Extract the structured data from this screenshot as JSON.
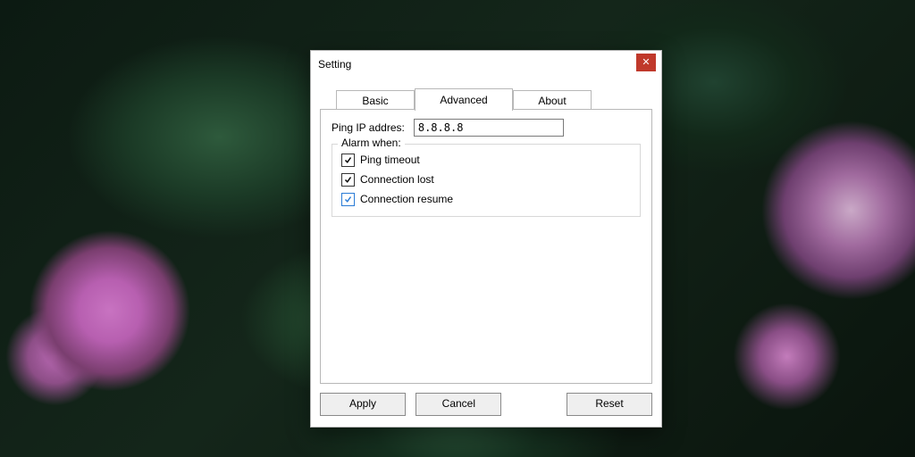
{
  "window": {
    "title": "Setting"
  },
  "tabs": {
    "basic": "Basic",
    "advanced": "Advanced",
    "about": "About",
    "active": "advanced"
  },
  "fields": {
    "ping_ip_label": "Ping IP addres:",
    "ping_ip_value": "8.8.8.8"
  },
  "alarm_group": {
    "legend": "Alarm when:",
    "items": [
      {
        "key": "ping_timeout",
        "label": "Ping timeout",
        "checked": true,
        "focused": false
      },
      {
        "key": "connection_lost",
        "label": "Connection lost",
        "checked": true,
        "focused": false
      },
      {
        "key": "connection_resume",
        "label": "Connection resume",
        "checked": true,
        "focused": true
      }
    ]
  },
  "buttons": {
    "apply": "Apply",
    "cancel": "Cancel",
    "reset": "Reset"
  }
}
